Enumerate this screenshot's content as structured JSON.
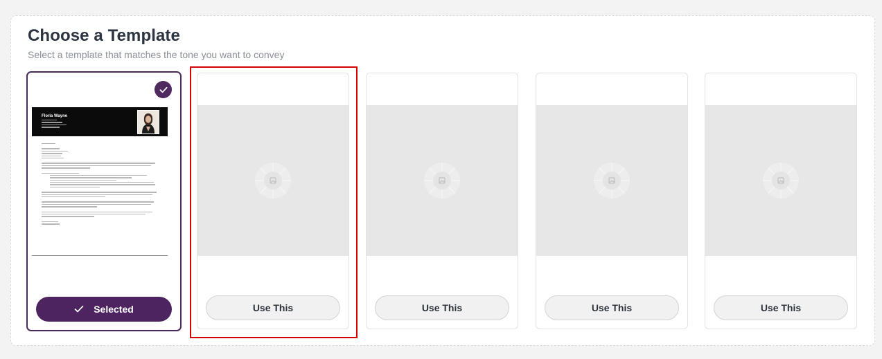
{
  "header": {
    "title": "Choose a Template",
    "subtitle": "Select a template that matches the tone you want to convey"
  },
  "templates": [
    {
      "status": "selected",
      "button_label": "Selected",
      "preview": {
        "name": "Floria Wayne"
      }
    },
    {
      "status": "loading",
      "button_label": "Use This"
    },
    {
      "status": "loading",
      "button_label": "Use This"
    },
    {
      "status": "loading",
      "button_label": "Use This"
    },
    {
      "status": "loading",
      "button_label": "Use This"
    }
  ],
  "colors": {
    "accent": "#4e2460",
    "highlight_box": "#d40000",
    "placeholder_bg": "#e7e7e8"
  },
  "icons": {
    "selected_badge": "check-icon",
    "placeholder": "image-placeholder-icon"
  }
}
